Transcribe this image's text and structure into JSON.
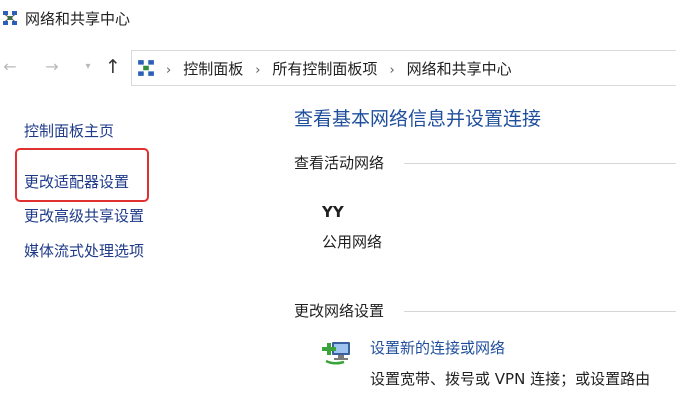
{
  "window": {
    "title": "网络和共享中心"
  },
  "nav": {
    "breadcrumbs": [
      "控制面板",
      "所有控制面板项",
      "网络和共享中心"
    ]
  },
  "sidebar": {
    "items": [
      "控制面板主页",
      "更改适配器设置",
      "更改高级共享设置",
      "媒体流式处理选项"
    ]
  },
  "main": {
    "heading": "查看基本网络信息并设置连接",
    "active_networks_label": "查看活动网络",
    "network": {
      "name": "YY",
      "type": "公用网络"
    },
    "change_settings_label": "更改网络设置",
    "task": {
      "link": "设置新的连接或网络",
      "description": "设置宽带、拨号或 VPN 连接；或设置路由"
    }
  },
  "colors": {
    "link": "#1f4f9c",
    "highlight": "#e03131"
  }
}
